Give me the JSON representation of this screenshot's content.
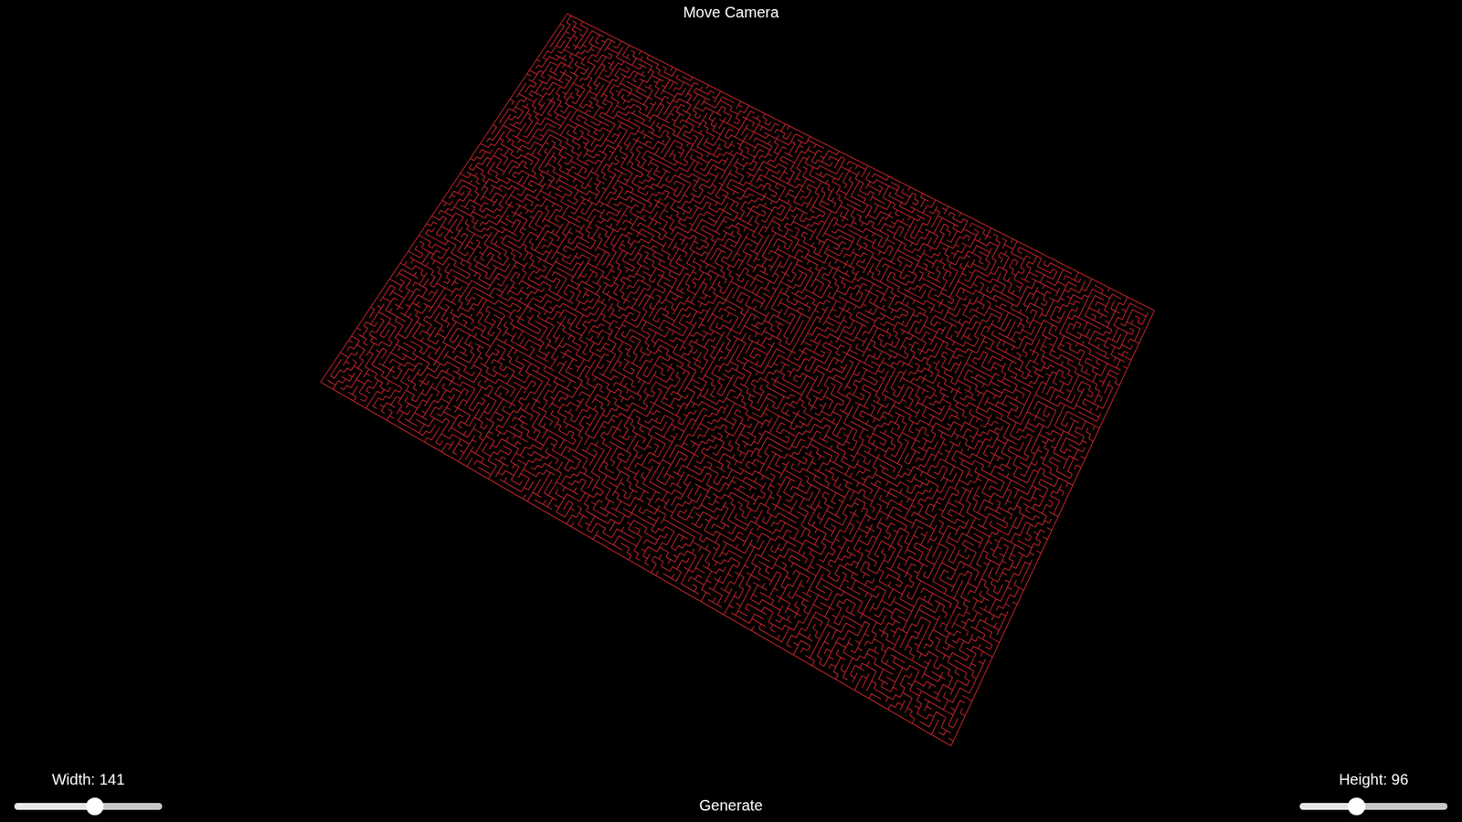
{
  "camera_button": {
    "label": "Move Camera"
  },
  "generate_button": {
    "label": "Generate"
  },
  "width_slider": {
    "label": "Width: 141",
    "level": 0.54
  },
  "height_slider": {
    "label": "Height: 96",
    "level": 0.38
  },
  "maze": {
    "columns": 141,
    "rows": 96,
    "color": "#c8262c"
  }
}
